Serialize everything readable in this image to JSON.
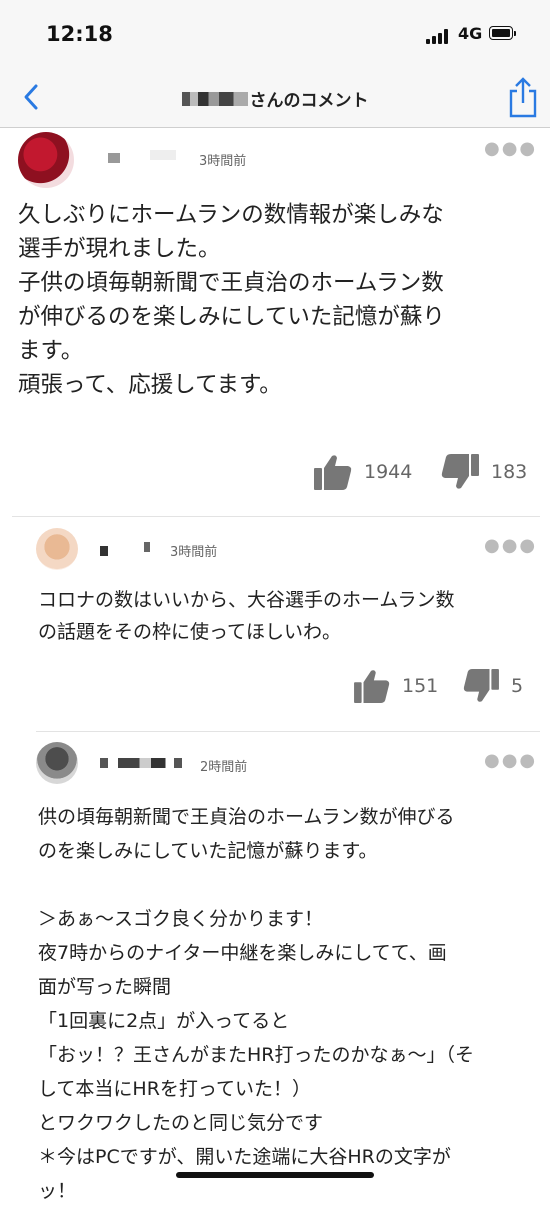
{
  "status_bar": {
    "time": "12:18",
    "network": "4G"
  },
  "header": {
    "title": "さんのコメント",
    "back_icon": "chevron-left-icon",
    "share_icon": "share-icon",
    "accent_color": "#2a7ae2"
  },
  "comments": [
    {
      "time": "3時間前",
      "text": "久しぶりにホームランの数情報が楽しみな\n選手が現れました。\n子供の頃毎朝新聞で王貞治のホームラン数\nが伸びるのを楽しみにしていた記憶が蘇り\nます。\n頑張って、応援してます。",
      "likes": "1944",
      "dislikes": "183"
    },
    {
      "time": "3時間前",
      "text": "コロナの数はいいから、大谷選手のホームラン数\nの話題をその枠に使ってほしいわ。",
      "likes": "151",
      "dislikes": "5"
    },
    {
      "time": "2時間前",
      "text": "供の頃毎朝新聞で王貞治のホームラン数が伸びる\nのを楽しみにしていた記憶が蘇ります。\n\n＞あぁ～スゴク良く分かります！\n夜7時からのナイター中継を楽しみにしてて、画\n面が写った瞬間\n「1回裏に2点」が入ってると\n「おッ！？王さんがまたHR打ったのかなぁ～」（そ\nして本当にHRを打っていた！）\nとワクワクしたのと同じ気分です\n＊今はPCですが、開いた途端に大谷HRの文字が\nッ！"
    }
  ]
}
